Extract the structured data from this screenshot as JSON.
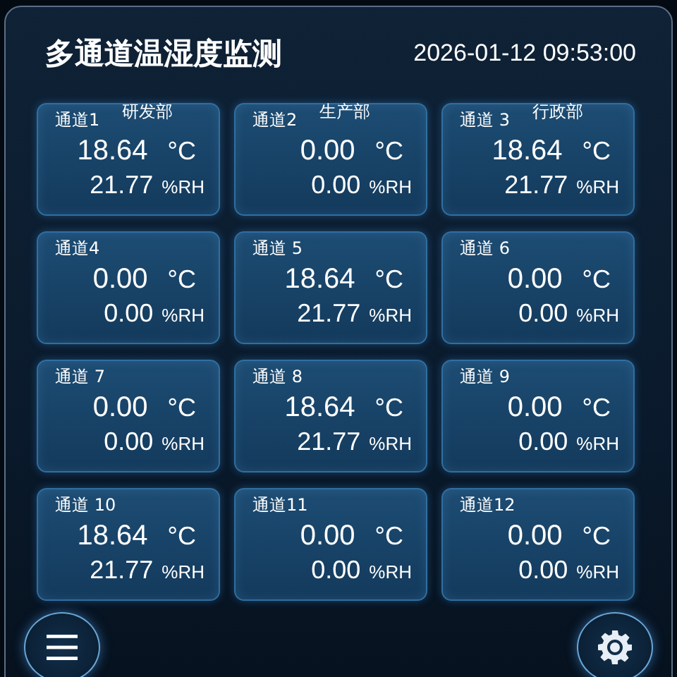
{
  "header": {
    "title": "多通道温湿度监测",
    "datetime": "2026-01-12 09:53:00"
  },
  "channels": [
    {
      "name": "通道1",
      "department": "研发部",
      "temperature": "18.64",
      "temp_unit": "°C",
      "humidity": "21.77",
      "hum_unit": "%RH"
    },
    {
      "name": "通道2",
      "department": "生产部",
      "temperature": "0.00",
      "temp_unit": "°C",
      "humidity": "0.00",
      "hum_unit": "%RH"
    },
    {
      "name": "通道 3",
      "department": "行政部",
      "temperature": "18.64",
      "temp_unit": "°C",
      "humidity": "21.77",
      "hum_unit": "%RH"
    },
    {
      "name": "通道4",
      "temperature": "0.00",
      "temp_unit": "°C",
      "humidity": "0.00",
      "hum_unit": "%RH"
    },
    {
      "name": "通道 5",
      "temperature": "18.64",
      "temp_unit": "°C",
      "humidity": "21.77",
      "hum_unit": "%RH"
    },
    {
      "name": "通道 6",
      "temperature": "0.00",
      "temp_unit": "°C",
      "humidity": "0.00",
      "hum_unit": "%RH"
    },
    {
      "name": "通道 7",
      "temperature": "0.00",
      "temp_unit": "°C",
      "humidity": "0.00",
      "hum_unit": "%RH"
    },
    {
      "name": "通道 8",
      "temperature": "18.64",
      "temp_unit": "°C",
      "humidity": "21.77",
      "hum_unit": "%RH"
    },
    {
      "name": "通道 9",
      "temperature": "0.00",
      "temp_unit": "°C",
      "humidity": "0.00",
      "hum_unit": "%RH"
    },
    {
      "name": "通道 10",
      "temperature": "18.64",
      "temp_unit": "°C",
      "humidity": "21.77",
      "hum_unit": "%RH"
    },
    {
      "name": "通道11",
      "temperature": "0.00",
      "temp_unit": "°C",
      "humidity": "0.00",
      "hum_unit": "%RH"
    },
    {
      "name": "通道12",
      "temperature": "0.00",
      "temp_unit": "°C",
      "humidity": "0.00",
      "hum_unit": "%RH"
    }
  ]
}
